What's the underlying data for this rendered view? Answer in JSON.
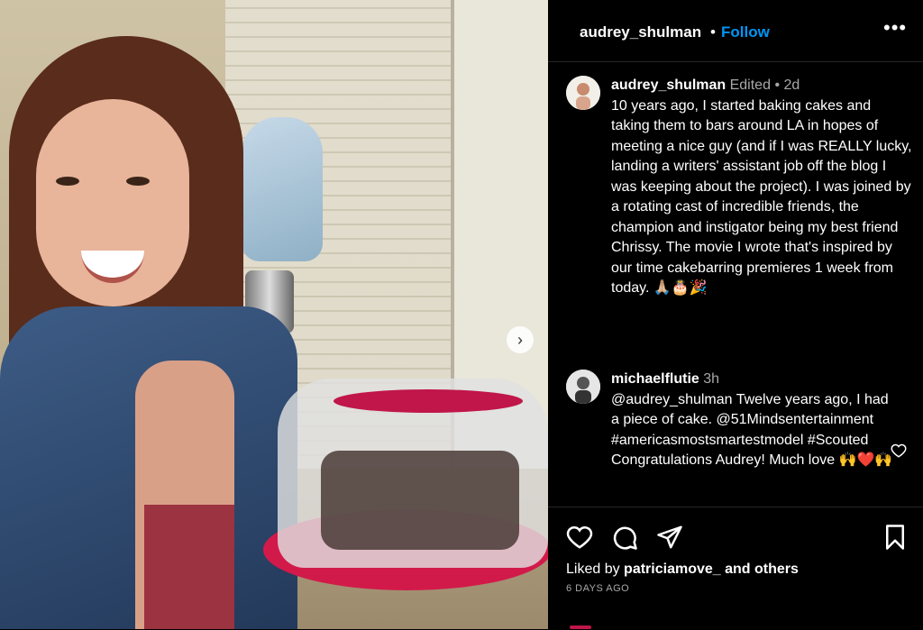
{
  "post": {
    "username": "audrey_shulman",
    "follow_label": "Follow",
    "dot": "•",
    "more_label": "•••",
    "next_label": "›"
  },
  "caption": {
    "username": "audrey_shulman",
    "edited": "Edited",
    "separator": "•",
    "age": "2d",
    "text": "10 years ago, I started baking cakes and taking them to bars around LA in hopes of meeting a nice guy (and if I was REALLY lucky, landing a writers' assistant job off the blog I was keeping about the project). I was joined by a rotating cast of incredible friends, the champion and instigator being my best friend Chrissy. The movie I wrote that's inspired by our time cakebarring premieres 1 week from today. 🙏🏼🎂🎉"
  },
  "comment": {
    "username": "michaelflutie",
    "age": "3h",
    "text": "@audrey_shulman Twelve years ago, I had a piece of cake. @51Mindsentertainment #americasmostsmartestmodel #Scouted Congratulations Audrey! Much love 🙌❤️🙌"
  },
  "footer": {
    "liked_by": "Liked by",
    "liker": "patriciamove_",
    "and_others": "and others",
    "date": "6 DAYS AGO"
  },
  "icons": {
    "like": "heart-icon",
    "comment": "comment-icon",
    "share": "share-icon",
    "save": "bookmark-icon",
    "more": "more-icon"
  }
}
